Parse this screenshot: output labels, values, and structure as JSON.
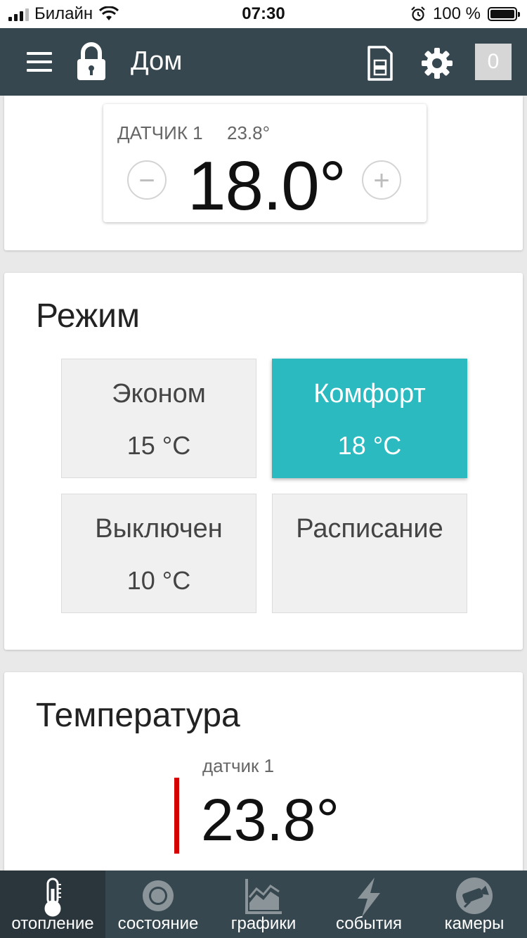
{
  "status_bar": {
    "carrier": "Билайн",
    "time": "07:30",
    "battery": "100 %",
    "battery_level": 1.0
  },
  "header": {
    "title": "Дом",
    "badge": "0"
  },
  "setpoint": {
    "sensor_label": "ДАТЧИК 1",
    "sensor_value": "23.8°",
    "value": "18.0°",
    "minus": "−",
    "plus": "+"
  },
  "mode_section": {
    "title": "Режим",
    "modes": [
      {
        "name": "Эконом",
        "temp": "15 °C",
        "active": false
      },
      {
        "name": "Комфорт",
        "temp": "18 °C",
        "active": true
      },
      {
        "name": "Выключен",
        "temp": "10 °C",
        "active": false
      },
      {
        "name": "Расписание",
        "temp": "",
        "active": false
      }
    ],
    "active_color": "#2ababf"
  },
  "temperature_section": {
    "title": "Температура",
    "sensor_label": "датчик 1",
    "value": "23.8°",
    "indicator_color": "#d50000"
  },
  "tabs": [
    {
      "label": "отопление",
      "icon": "thermometer-icon",
      "active": true,
      "color": "#ffffff"
    },
    {
      "label": "состояние",
      "icon": "ring-icon",
      "active": false,
      "color": "#ffffff"
    },
    {
      "label": "графики",
      "icon": "chart-icon",
      "active": false,
      "color": "#ffffff"
    },
    {
      "label": "события",
      "icon": "lightning-icon",
      "active": false,
      "color": "#ffffff"
    },
    {
      "label": "камеры",
      "icon": "camera-icon",
      "active": false,
      "color": "#ffffff"
    }
  ],
  "colors": {
    "header_bg": "#37474f",
    "tab_active_bg": "#2a363c",
    "icon_inactive": "#8a9499"
  }
}
